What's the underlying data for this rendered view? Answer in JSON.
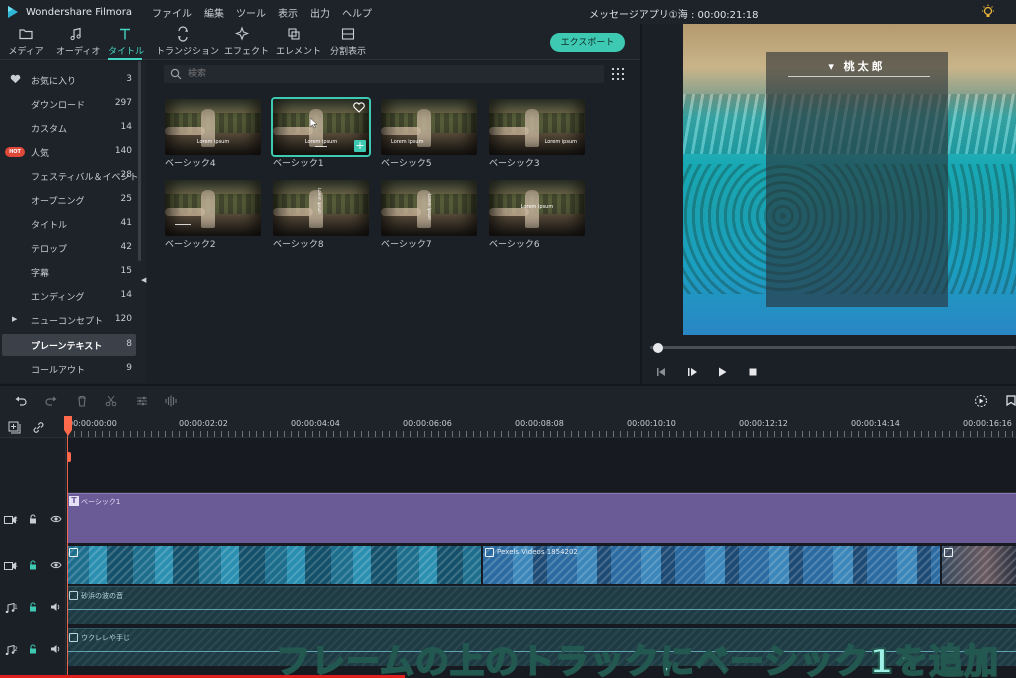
{
  "app": {
    "title": "Wondershare Filmora",
    "project": "メッセージアプリ①海 : 00:00:21:18"
  },
  "menu": [
    "ファイル",
    "編集",
    "ツール",
    "表示",
    "出力",
    "ヘルプ"
  ],
  "toolbar": {
    "tabs": [
      {
        "label": "メディア",
        "icon": "folder-icon"
      },
      {
        "label": "オーディオ",
        "icon": "music-note-icon"
      },
      {
        "label": "タイトル",
        "icon": "text-t-icon"
      },
      {
        "label": "トランジション",
        "icon": "transition-icon"
      },
      {
        "label": "エフェクト",
        "icon": "effect-sparkle-icon"
      },
      {
        "label": "エレメント",
        "icon": "element-icon"
      },
      {
        "label": "分割表示",
        "icon": "split-screen-icon"
      }
    ],
    "active_tab": "タイトル",
    "export_label": "エクスポート"
  },
  "sidebar": {
    "categories": [
      {
        "name": "お気に入り",
        "count": "3",
        "icon": "heart-icon"
      },
      {
        "name": "ダウンロード",
        "count": "297"
      },
      {
        "name": "カスタム",
        "count": "14"
      },
      {
        "name": "人気",
        "count": "140",
        "badge": "HOT"
      },
      {
        "name": "フェスティバル＆イベント",
        "count": "28"
      },
      {
        "name": "オープニング",
        "count": "25"
      },
      {
        "name": "タイトル",
        "count": "41"
      },
      {
        "name": "テロップ",
        "count": "42"
      },
      {
        "name": "字幕",
        "count": "15"
      },
      {
        "name": "エンディング",
        "count": "14"
      },
      {
        "name": "ニューコンセプト",
        "count": "120",
        "expandable": true
      },
      {
        "name": "プレーンテキスト",
        "count": "8",
        "selected": true
      },
      {
        "name": "コールアウト",
        "count": "9"
      }
    ]
  },
  "library": {
    "search_placeholder": "検索",
    "thumb_text": "Lorem ipsum",
    "items": [
      {
        "label": "ベーシック4"
      },
      {
        "label": "ベーシック1",
        "selected": true
      },
      {
        "label": "ベーシック5"
      },
      {
        "label": "ベーシック3"
      },
      {
        "label": "ベーシック2"
      },
      {
        "label": "ベーシック8"
      },
      {
        "label": "ベーシック7"
      },
      {
        "label": "ベーシック6"
      }
    ]
  },
  "preview": {
    "title_text": "▾ 桃太郎",
    "playback_progress": 0.0
  },
  "timeline": {
    "ruler": [
      "00:00:00:00",
      "00:00:02:02",
      "00:00:04:04",
      "00:00:06:06",
      "00:00:08:08",
      "00:00:10:10",
      "00:00:12:12",
      "00:00:14:14",
      "00:00:16:16"
    ],
    "tracks": {
      "title_track_num": "2",
      "video_track_num": "1",
      "audio1_num": "1",
      "audio2_num": "2"
    },
    "title_clip": "ベーシック1",
    "video_clip_2": "Pexels Videos 1854202",
    "audio_clip_1": "砂浜の波の音",
    "audio_clip_2": "ウクレレや手じ"
  },
  "caption": "フレームの上のトラックにベーシック1を追加",
  "colors": {
    "accent": "#3ec9b2",
    "playhead": "#ff6a4d",
    "title_clip": "#6a5a96",
    "hot_badge": "#e0493a"
  }
}
